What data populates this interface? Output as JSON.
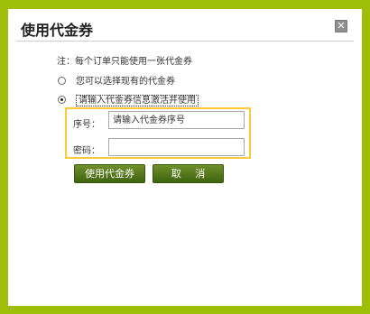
{
  "dialog": {
    "title": "使用代金券",
    "close_glyph": "✕"
  },
  "note": "注：每个订单只能使用一张代金券",
  "options": [
    {
      "label": "您可以选择现有的代金券",
      "checked": false
    },
    {
      "label": "请输入代金券信息激活并使用",
      "checked": true
    }
  ],
  "form": {
    "serial_label": "序号：",
    "serial_placeholder": "请输入代金券序号",
    "password_label": "密码：",
    "password_value": ""
  },
  "buttons": {
    "use_label": "使用代金券",
    "cancel_label": "取 消"
  },
  "colors": {
    "page_background": "#9fbe0a",
    "highlight_border": "#ffc836",
    "button_green": "#4f7419"
  }
}
